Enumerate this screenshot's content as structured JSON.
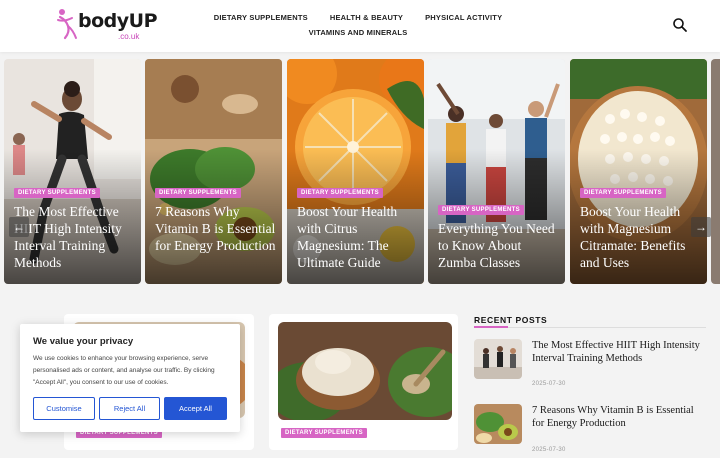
{
  "header": {
    "logo_main": "bodyUP",
    "logo_sub": ".co.uk",
    "nav_row1": [
      "DIETARY SUPPLEMENTS",
      "HEALTH & BEAUTY",
      "PHYSICAL ACTIVITY"
    ],
    "nav_row2": [
      "VITAMINS AND MINERALS"
    ]
  },
  "slider": {
    "prev": "←",
    "next": "→",
    "slides": [
      {
        "category": "DIETARY SUPPLEMENTS",
        "title": "The Most Effective HIIT High Intensity Interval Training Methods"
      },
      {
        "category": "DIETARY SUPPLEMENTS",
        "title": "7 Reasons Why Vitamin B is Essential for Energy Production"
      },
      {
        "category": "DIETARY SUPPLEMENTS",
        "title": "Boost Your Health with Citrus Magnesium: The Ultimate Guide"
      },
      {
        "category": "DIETARY SUPPLEMENTS",
        "title": "Everything You Need to Know About Zumba Classes"
      },
      {
        "category": "DIETARY SUPPLEMENTS",
        "title": "Boost Your Health with Magnesium Citramate: Benefits and Uses"
      }
    ]
  },
  "main": {
    "cards": [
      {
        "category": "DIETARY SUPPLEMENTS"
      },
      {
        "category": "DIETARY SUPPLEMENTS"
      }
    ]
  },
  "sidebar": {
    "title": "RECENT POSTS",
    "posts": [
      {
        "title": "The Most Effective HIIT High Intensity Interval Training Methods",
        "date": "2025-07-30"
      },
      {
        "title": "7 Reasons Why Vitamin B is Essential for Energy Production",
        "date": "2025-07-30"
      }
    ]
  },
  "cookie": {
    "title": "We value your privacy",
    "text": "We use cookies to enhance your browsing experience, serve personalised ads or content, and analyse our traffic. By clicking \"Accept All\", you consent to our use of cookies.",
    "customise": "Customise",
    "reject": "Reject All",
    "accept": "Accept All"
  },
  "colors": {
    "accent": "#d765c4",
    "button_blue": "#2456d4"
  }
}
